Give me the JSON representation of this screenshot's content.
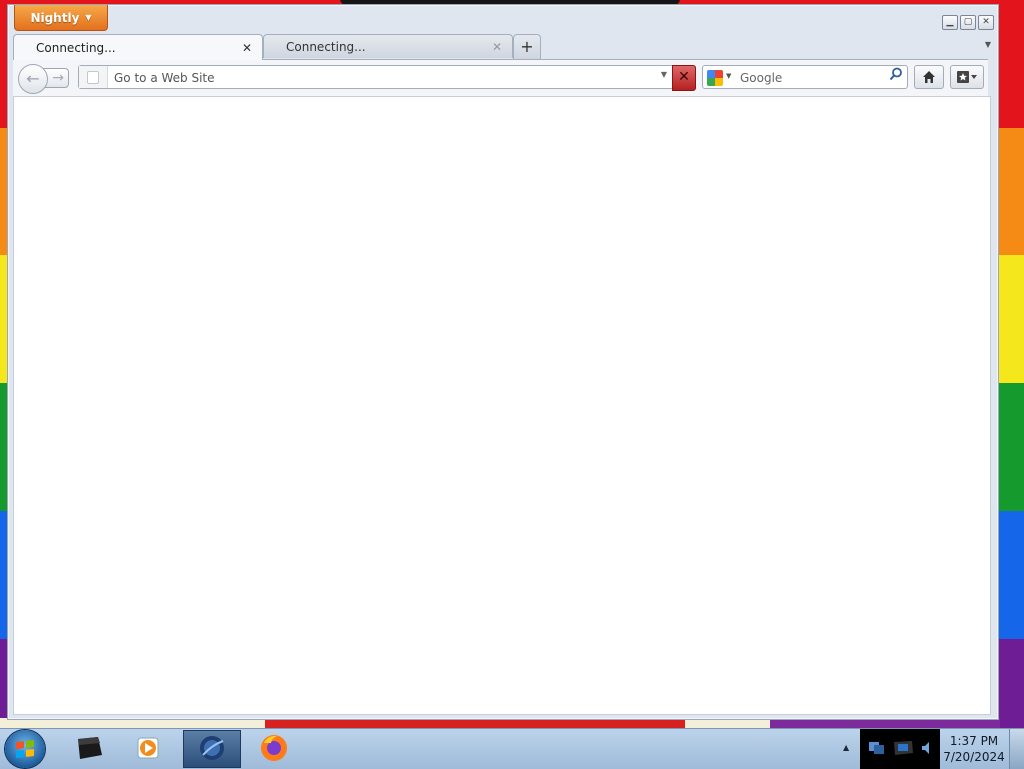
{
  "browser": {
    "app_menu_label": "Nightly",
    "tabs": [
      {
        "title": "Connecting...",
        "active": true
      },
      {
        "title": "Connecting...",
        "active": false
      }
    ],
    "new_tab_label": "+",
    "close_tab_glyph": "✕",
    "back_glyph": "←",
    "forward_glyph": "→",
    "url_placeholder": "Go to a Web Site",
    "url_value": "",
    "stop_glyph": "✕",
    "search_engine": "Google",
    "search_placeholder": "Google",
    "icons": [
      "back-icon",
      "forward-icon",
      "page-icon",
      "stop-icon",
      "google-icon",
      "magnifier-icon",
      "home-icon",
      "bookmark-icon"
    ]
  },
  "window_controls": {
    "minimize": "▁",
    "maximize": "▢",
    "close": "✕"
  },
  "taskbar": {
    "clock_time": "1:37 PM",
    "clock_date": "7/20/2024",
    "pinned_apps": [
      "terminal-icon",
      "media-player-icon",
      "globe-browser-icon",
      "firefox-icon"
    ],
    "tray_arrow": "▲"
  },
  "colors": {
    "app_button": "#e3701e",
    "stop_button": "#b52020",
    "taskbar": "#9fbbd9",
    "wallpaper": [
      "#e3141b",
      "#f58a14",
      "#f4e71c",
      "#159a2e",
      "#1566e8",
      "#6e1d95"
    ]
  }
}
